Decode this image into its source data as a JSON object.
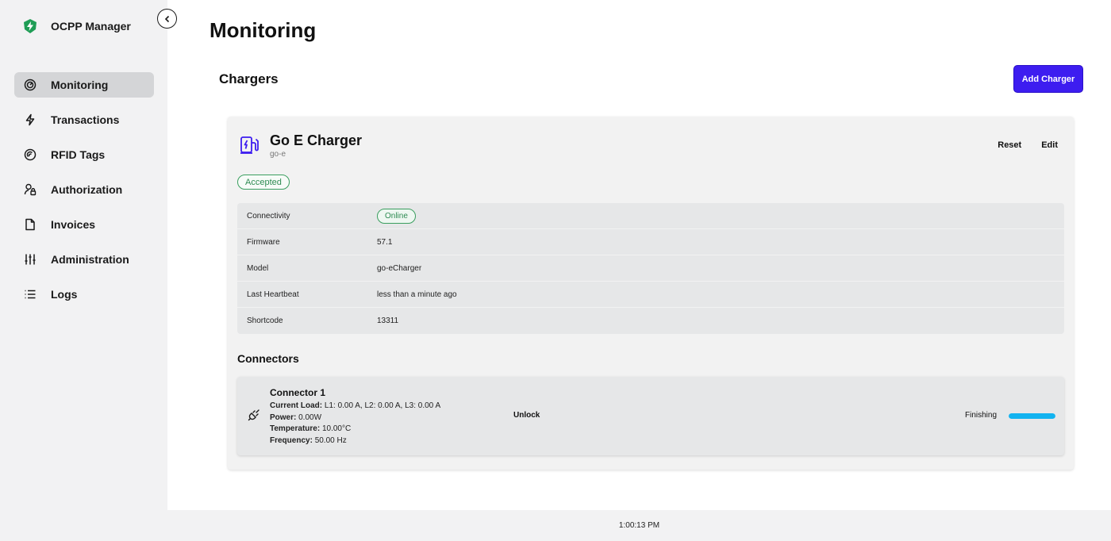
{
  "app": {
    "name": "OCPP Manager"
  },
  "sidebar": {
    "items": [
      {
        "label": "Monitoring",
        "icon": "gauge-icon",
        "active": true
      },
      {
        "label": "Transactions",
        "icon": "bolt-icon",
        "active": false
      },
      {
        "label": "RFID Tags",
        "icon": "rfid-tag-icon",
        "active": false
      },
      {
        "label": "Authorization",
        "icon": "user-lock-icon",
        "active": false
      },
      {
        "label": "Invoices",
        "icon": "document-icon",
        "active": false
      },
      {
        "label": "Administration",
        "icon": "sliders-icon",
        "active": false
      },
      {
        "label": "Logs",
        "icon": "list-icon",
        "active": false
      }
    ]
  },
  "main": {
    "title": "Monitoring",
    "section_title": "Chargers",
    "add_button_label": "Add Charger"
  },
  "charger": {
    "name": "Go E Charger",
    "id": "go-e",
    "reset_label": "Reset",
    "edit_label": "Edit",
    "status": "Accepted",
    "details": [
      {
        "key": "Connectivity",
        "value": "Online",
        "badge": true
      },
      {
        "key": "Firmware",
        "value": "57.1"
      },
      {
        "key": "Model",
        "value": "go-eCharger"
      },
      {
        "key": "Last Heartbeat",
        "value": "less than a minute ago"
      },
      {
        "key": "Shortcode",
        "value": "13311"
      }
    ],
    "connectors_title": "Connectors",
    "connector": {
      "name": "Connector 1",
      "current_load_label": "Current Load:",
      "current_load_value": "L1: 0.00 A, L2: 0.00 A, L3: 0.00 A",
      "power_label": "Power:",
      "power_value": "0.00W",
      "temperature_label": "Temperature:",
      "temperature_value": "10.00°C",
      "frequency_label": "Frequency:",
      "frequency_value": "50.00 Hz",
      "unlock_label": "Unlock",
      "status": "Finishing",
      "progress": 1.0
    }
  },
  "footer": {
    "time": "1:00:13 PM"
  },
  "colors": {
    "accent": "#3d1df0",
    "success": "#2e8b52",
    "progress": "#12b3f0",
    "logo": "#1f9d55"
  }
}
